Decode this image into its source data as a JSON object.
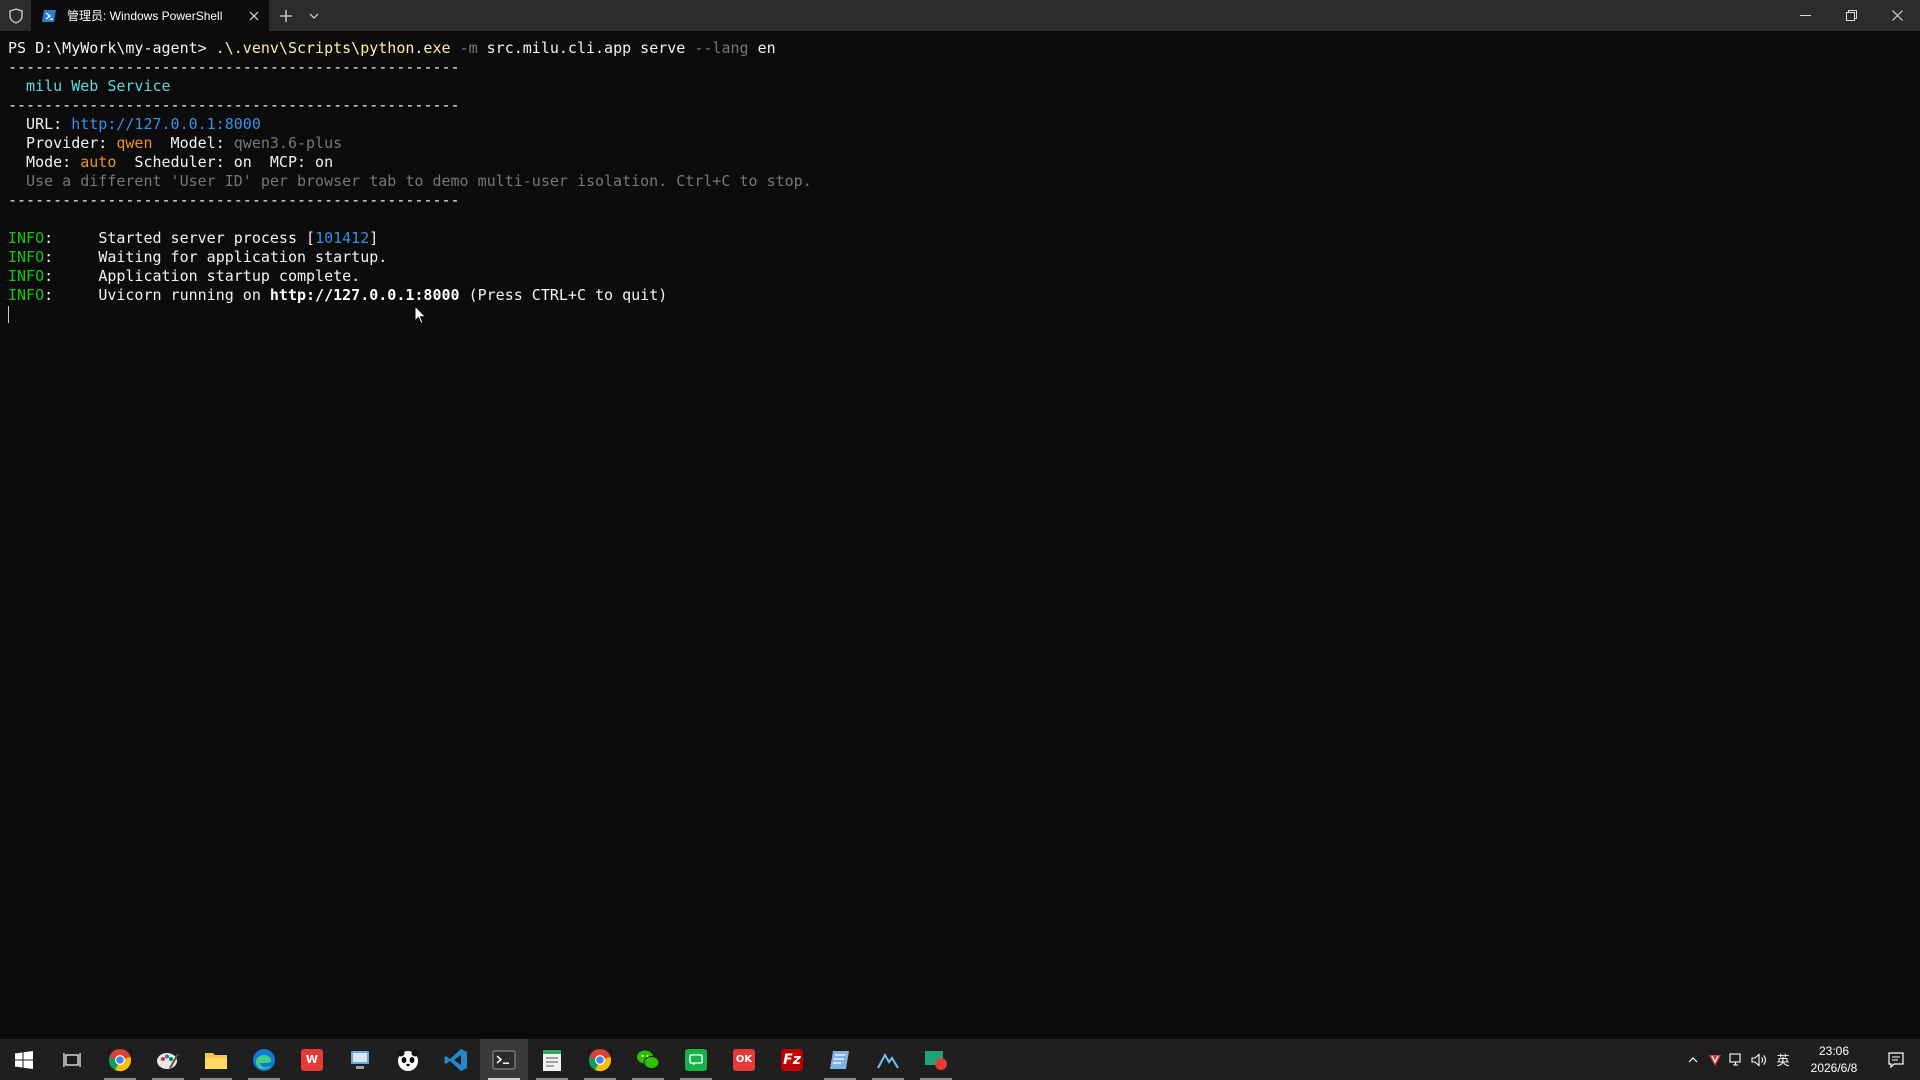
{
  "window": {
    "tab_title": "管理员: Windows PowerShell"
  },
  "terminal": {
    "prompt": "PS D:\\MyWork\\my-agent> ",
    "cmd_exe": ".\\.venv\\Scripts\\python.exe",
    "cmd_flag": " -m ",
    "cmd_args": "src.milu.cli.app serve ",
    "cmd_langflag": "--lang",
    "cmd_lang": " en",
    "rule": "--------------------------------------------------",
    "service_title": "  milu Web Service",
    "url_label": "  URL: ",
    "url_value": "http://127.0.0.1:8000",
    "provider_label": "  Provider: ",
    "provider_value": "qwen",
    "model_label": "  Model: ",
    "model_value": "qwen3.6-plus",
    "mode_label": "  Mode: ",
    "mode_value": "auto",
    "scheduler_text": "  Scheduler: on  MCP: on",
    "hint": "  Use a different 'User ID' per browser tab to demo multi-user isolation. Ctrl+C to stop.",
    "log_level": "INFO",
    "log_colon": ":     ",
    "log1_text": "Started server process [",
    "log1_pid": "101412",
    "log1_end": "]",
    "log2_text": "Waiting for application startup.",
    "log3_text": "Application startup complete.",
    "log4_pre": "Uvicorn running on ",
    "log4_url": "http://127.0.0.1:8000",
    "log4_post": " (Press CTRL+C to quit)"
  },
  "taskbar": {
    "apps": [
      "start-icon",
      "task-view-icon",
      "chrome-icon",
      "paint-icon",
      "file-explorer-icon",
      "edge-icon",
      "wps-icon",
      "network-app-icon",
      "panda-app-icon",
      "vscode-icon",
      "terminal-icon",
      "notepad-icon",
      "chrome-icon",
      "wechat-icon",
      "messaging-icon",
      "ok-app-icon",
      "filezilla-icon",
      "notes-app-icon",
      "tool-app-icon",
      "recorder-icon"
    ],
    "ime": "英",
    "time": "23:06",
    "date": "2026/6/8"
  }
}
